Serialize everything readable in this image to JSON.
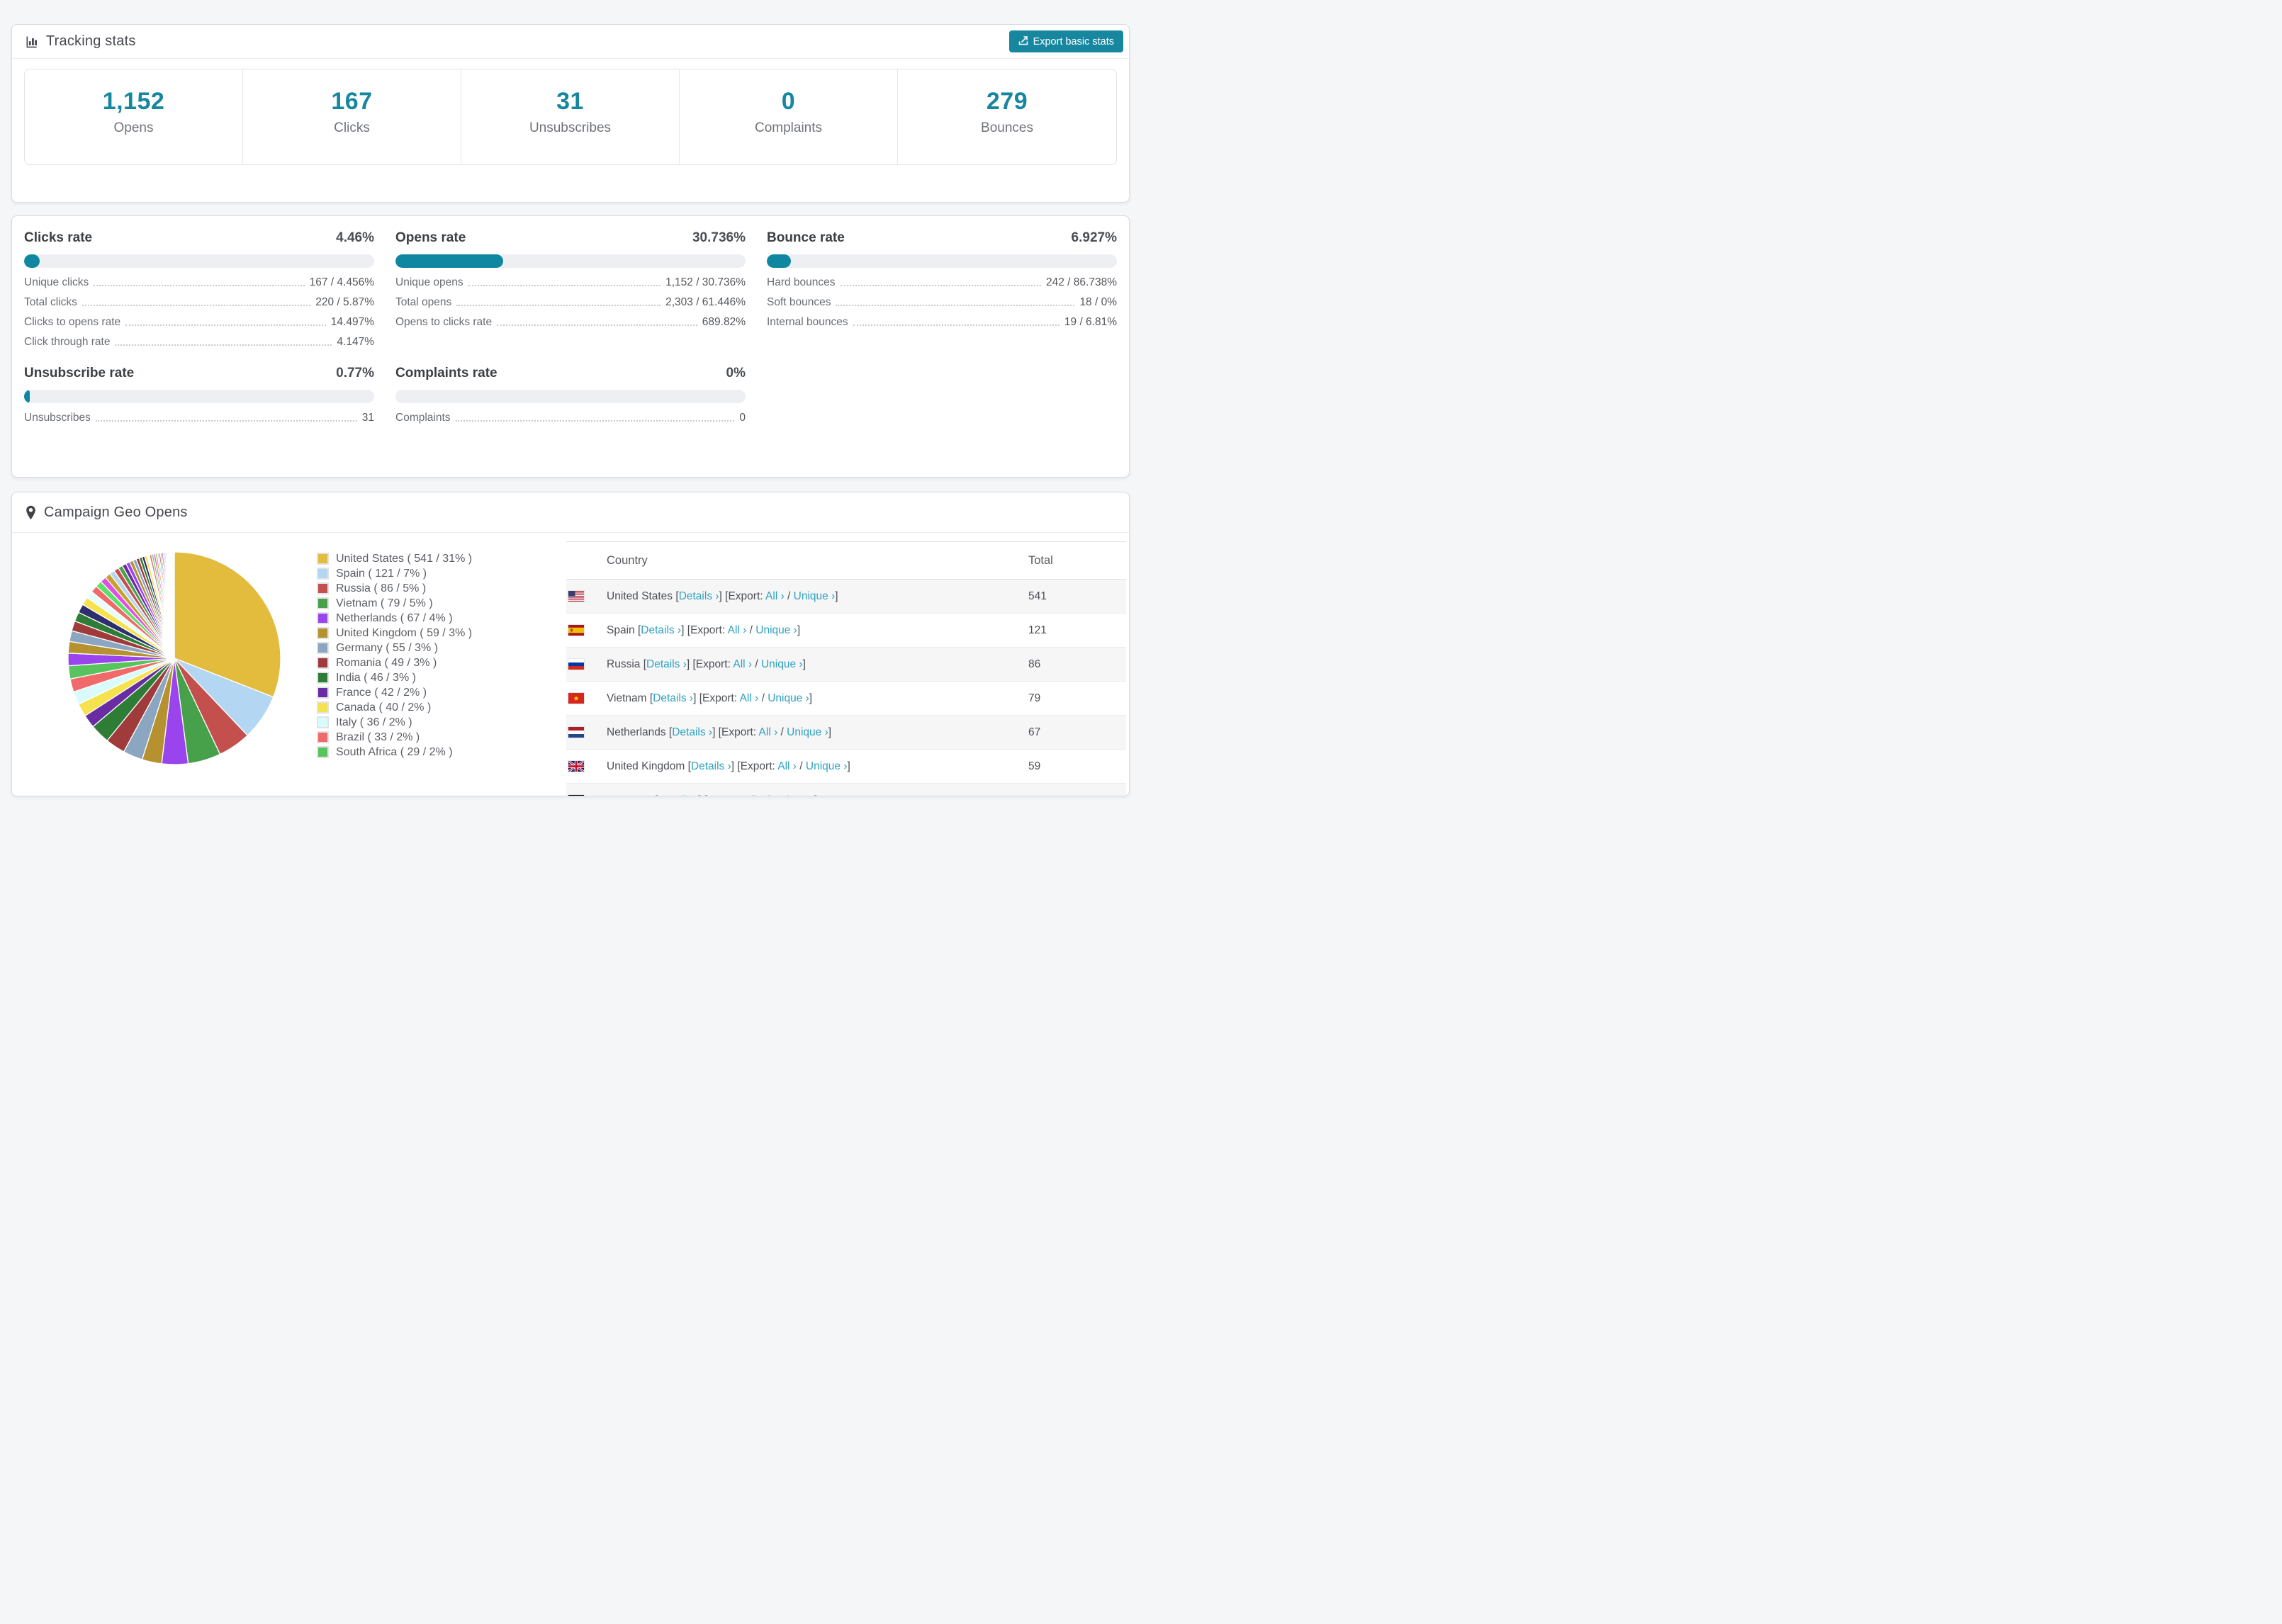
{
  "header": {
    "title": "Tracking stats",
    "export_button": "Export basic stats"
  },
  "summary_stats": [
    {
      "value": "1,152",
      "label": "Opens"
    },
    {
      "value": "167",
      "label": "Clicks"
    },
    {
      "value": "31",
      "label": "Unsubscribes"
    },
    {
      "value": "0",
      "label": "Complaints"
    },
    {
      "value": "279",
      "label": "Bounces"
    }
  ],
  "rate_blocks": [
    {
      "title": "Clicks rate",
      "value": "4.46%",
      "percent": 4.46,
      "rows": [
        {
          "label": "Unique clicks",
          "value": "167 / 4.456%"
        },
        {
          "label": "Total clicks",
          "value": "220 / 5.87%"
        },
        {
          "label": "Clicks to opens rate",
          "value": "14.497%"
        },
        {
          "label": "Click through rate",
          "value": "4.147%"
        }
      ]
    },
    {
      "title": "Opens rate",
      "value": "30.736%",
      "percent": 30.736,
      "rows": [
        {
          "label": "Unique opens",
          "value": "1,152 / 30.736%"
        },
        {
          "label": "Total opens",
          "value": "2,303 / 61.446%"
        },
        {
          "label": "Opens to clicks rate",
          "value": "689.82%"
        }
      ]
    },
    {
      "title": "Bounce rate",
      "value": "6.927%",
      "percent": 6.927,
      "rows": [
        {
          "label": "Hard bounces",
          "value": "242 / 86.738%"
        },
        {
          "label": "Soft bounces",
          "value": "18 / 0%"
        },
        {
          "label": "Internal bounces",
          "value": "19 / 6.81%"
        }
      ]
    },
    {
      "title": "Unsubscribe rate",
      "value": "0.77%",
      "percent": 0.77,
      "rows": [
        {
          "label": "Unsubscribes",
          "value": "31"
        }
      ]
    },
    {
      "title": "Complaints rate",
      "value": "0%",
      "percent": 0,
      "rows": [
        {
          "label": "Complaints",
          "value": "0"
        }
      ]
    }
  ],
  "geo": {
    "title": "Campaign Geo Opens",
    "table": {
      "headers": [
        "Country",
        "Total"
      ],
      "links": {
        "details": "Details ›",
        "export_prefix": "Export:",
        "all": "All ›",
        "unique": "Unique ›"
      },
      "rows": [
        {
          "country": "United States",
          "flag": "us",
          "total": "541"
        },
        {
          "country": "Spain",
          "flag": "es",
          "total": "121"
        },
        {
          "country": "Russia",
          "flag": "ru",
          "total": "86"
        },
        {
          "country": "Vietnam",
          "flag": "vn",
          "total": "79"
        },
        {
          "country": "Netherlands",
          "flag": "nl",
          "total": "67"
        },
        {
          "country": "United Kingdom",
          "flag": "gb",
          "total": "59"
        },
        {
          "country": "Germany",
          "flag": "de",
          "total": "",
          "partial": true
        }
      ]
    }
  },
  "chart_data": {
    "type": "pie",
    "title": "Campaign Geo Opens",
    "labels": [
      "United States",
      "Spain",
      "Russia",
      "Vietnam",
      "Netherlands",
      "United Kingdom",
      "Germany",
      "Romania",
      "India",
      "France",
      "Canada",
      "Italy",
      "Brazil",
      "South Africa"
    ],
    "values": [
      541,
      121,
      86,
      79,
      67,
      59,
      55,
      49,
      46,
      42,
      40,
      36,
      33,
      29
    ],
    "percents": [
      31,
      7,
      5,
      5,
      4,
      3,
      3,
      3,
      3,
      2,
      2,
      2,
      2,
      2
    ],
    "colors": [
      "#e3bb3d",
      "#b3d7f2",
      "#c4504e",
      "#47a14b",
      "#9a44ee",
      "#b5922f",
      "#8ba6c1",
      "#a03b3b",
      "#2e7d36",
      "#6a2ca2",
      "#f6e14e",
      "#d9fbfb",
      "#f06a6a",
      "#58c45e"
    ],
    "legend_position": "right",
    "start_angle_deg": 0,
    "direction": "clockwise",
    "legend_label_format": "{label} ( {value} / {percent}% )",
    "other_slices": {
      "note": "long tail of many small unlabeled country slices completing the circle",
      "count": 46,
      "start_percent": 1.9,
      "decay": 0.93,
      "palette_cycle": [
        "#9a44ee",
        "#b5922f",
        "#8ba6c1",
        "#a03b3b",
        "#2e7d36",
        "#2e2e6e",
        "#f6e14e",
        "#e8fdfd",
        "#f06a6a",
        "#5ce06a",
        "#e14fe1",
        "#c9a02e",
        "#b3d7f2",
        "#c4504e",
        "#47a14b",
        "#6a2ca2"
      ]
    }
  },
  "colors": {
    "accent": "#17869f",
    "link": "#2ea2c1",
    "bar_track": "#edeff3"
  }
}
